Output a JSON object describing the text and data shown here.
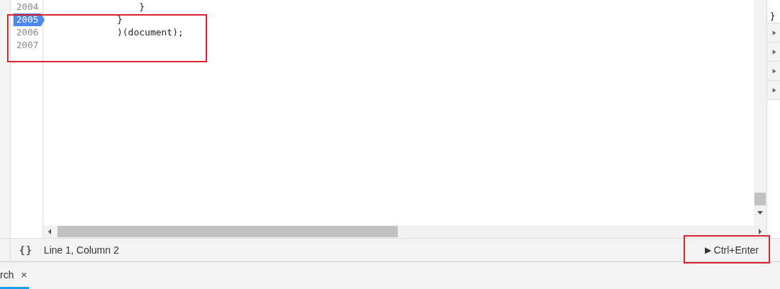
{
  "editor": {
    "lines": [
      {
        "number": "2004",
        "code": "                }",
        "breakpoint": false
      },
      {
        "number": "2005",
        "code": "            }",
        "breakpoint": true
      },
      {
        "number": "2006",
        "code": "            )(document);",
        "breakpoint": false
      },
      {
        "number": "2007",
        "breakpoint": false
      }
    ]
  },
  "side_panel": {
    "text": "}",
    "rows": [
      {
        "expanded": false
      },
      {
        "expanded": false
      },
      {
        "expanded": false
      },
      {
        "expanded": false
      }
    ]
  },
  "status_bar": {
    "format_button": "{}",
    "position": "Line 1, Column 2",
    "run_button": {
      "icon": "▶",
      "label": "Ctrl+Enter"
    }
  },
  "drawer_tabs": [
    {
      "label": "rch",
      "close": "×",
      "selected": true
    }
  ]
}
